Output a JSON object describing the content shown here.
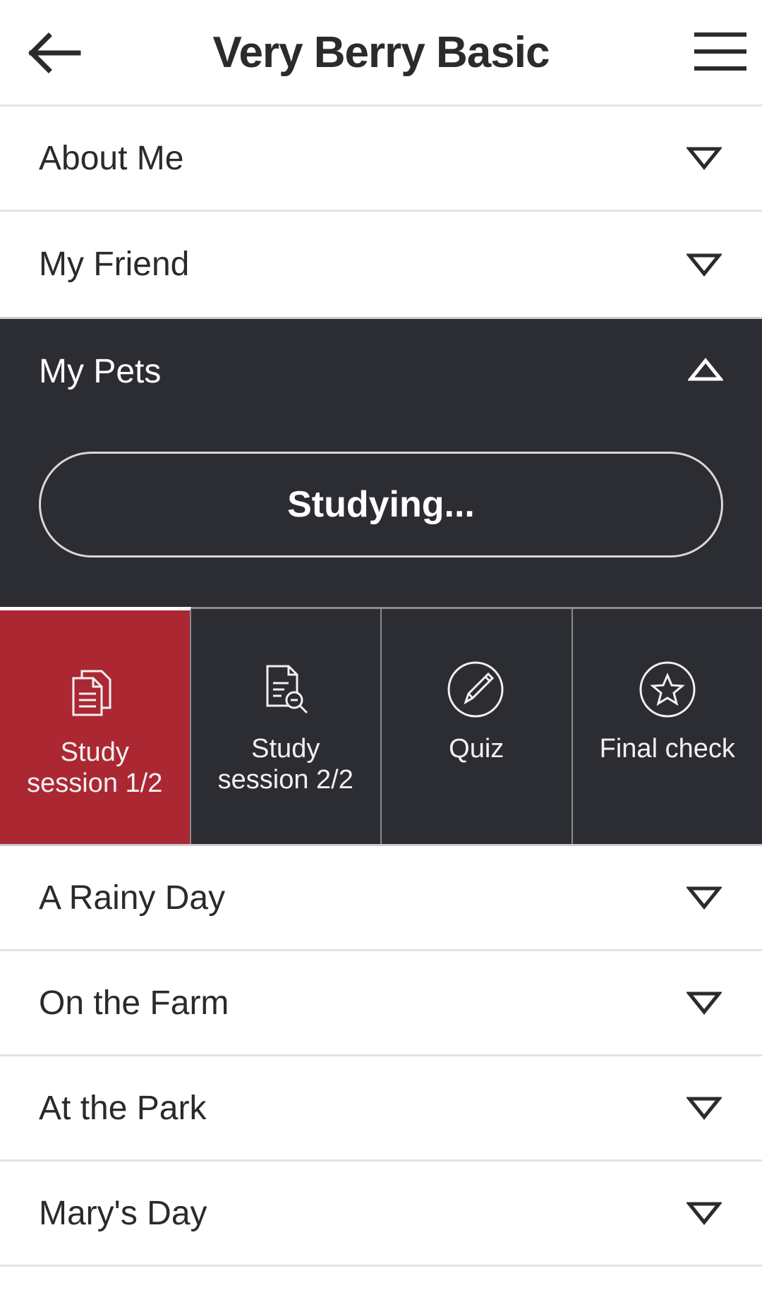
{
  "header": {
    "title": "Very Berry Basic"
  },
  "lessons_before": [
    {
      "label": "About Me"
    },
    {
      "label": "My Friend"
    }
  ],
  "expanded": {
    "label": "My Pets",
    "status_button": "Studying...",
    "tabs": [
      {
        "label": "Study\nsession 1/2",
        "icon": "documents-icon",
        "active": true
      },
      {
        "label": "Study\nsession 2/2",
        "icon": "document-search-icon",
        "active": false
      },
      {
        "label": "Quiz",
        "icon": "pencil-circle-icon",
        "active": false
      },
      {
        "label": "Final check",
        "icon": "star-circle-icon",
        "active": false
      }
    ]
  },
  "lessons_after": [
    {
      "label": "A Rainy Day"
    },
    {
      "label": "On the Farm"
    },
    {
      "label": "At the Park"
    },
    {
      "label": "Mary's Day"
    }
  ],
  "colors": {
    "active_tab": "#ab2833",
    "dark_panel": "#2c2d33"
  }
}
